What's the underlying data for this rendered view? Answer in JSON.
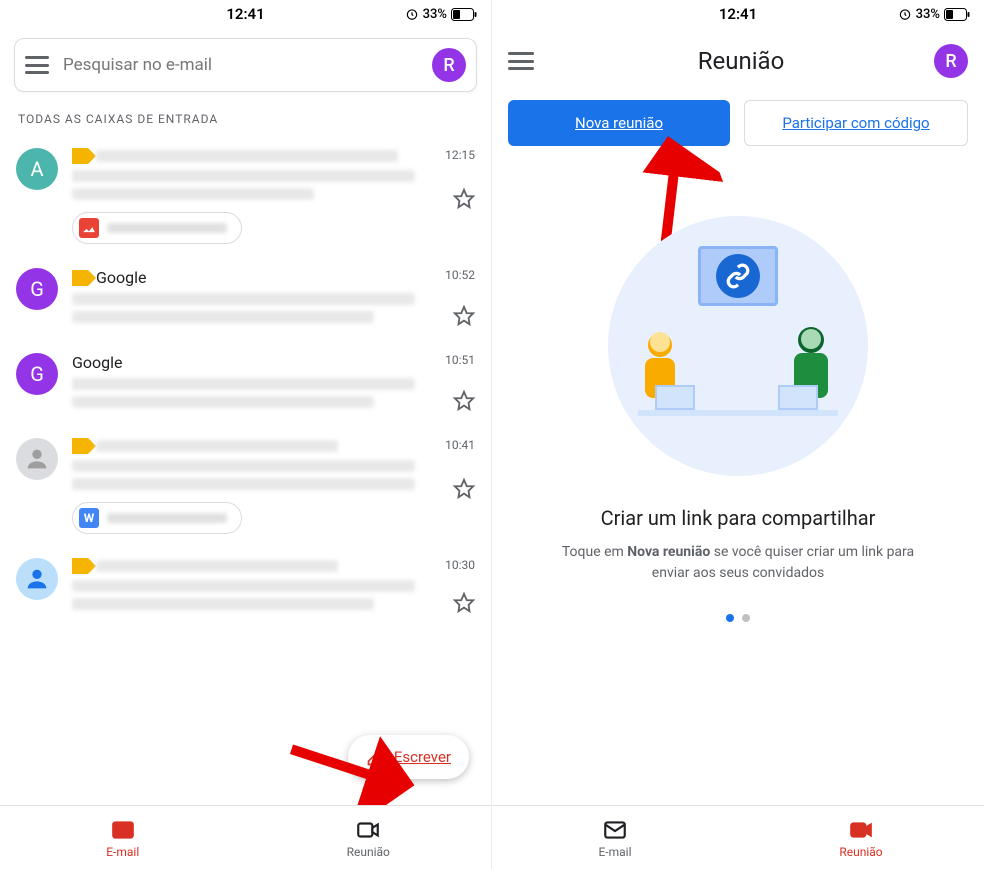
{
  "status": {
    "time": "12:41",
    "battery": "33%"
  },
  "left": {
    "search": {
      "placeholder": "Pesquisar no e-mail",
      "avatar_letter": "R"
    },
    "section_label": "TODAS AS CAIXAS DE ENTRADA",
    "emails": [
      {
        "avatar_letter": "A",
        "avatar_color": "#4db6ac",
        "sender": "",
        "time": "12:15",
        "important": true,
        "attachment_icon": "image"
      },
      {
        "avatar_letter": "G",
        "avatar_color": "#9334e6",
        "sender": "Google",
        "time": "10:52",
        "important": true
      },
      {
        "avatar_letter": "G",
        "avatar_color": "#9334e6",
        "sender": "Google",
        "time": "10:51",
        "important": false
      },
      {
        "avatar_letter": "",
        "avatar_color": "#dadce0",
        "sender": "",
        "time": "10:41",
        "important": true,
        "attachment_icon": "word"
      },
      {
        "avatar_letter": "",
        "avatar_color": "#bbdefb",
        "sender": "",
        "time": "10:30",
        "important": true,
        "person_icon": true
      }
    ],
    "fab_label": "Escrever",
    "nav": {
      "email": "E-mail",
      "meet": "Reunião",
      "active": "email"
    }
  },
  "right": {
    "header_title": "Reunião",
    "avatar_letter": "R",
    "buttons": {
      "primary": "Nova reunião",
      "secondary": "Participar com código"
    },
    "promo": {
      "title": "Criar um link para compartilhar",
      "text_before": "Toque em ",
      "text_bold": "Nova reunião",
      "text_after": " se você quiser criar um link para enviar aos seus convidados"
    },
    "nav": {
      "email": "E-mail",
      "meet": "Reunião",
      "active": "meet"
    }
  }
}
